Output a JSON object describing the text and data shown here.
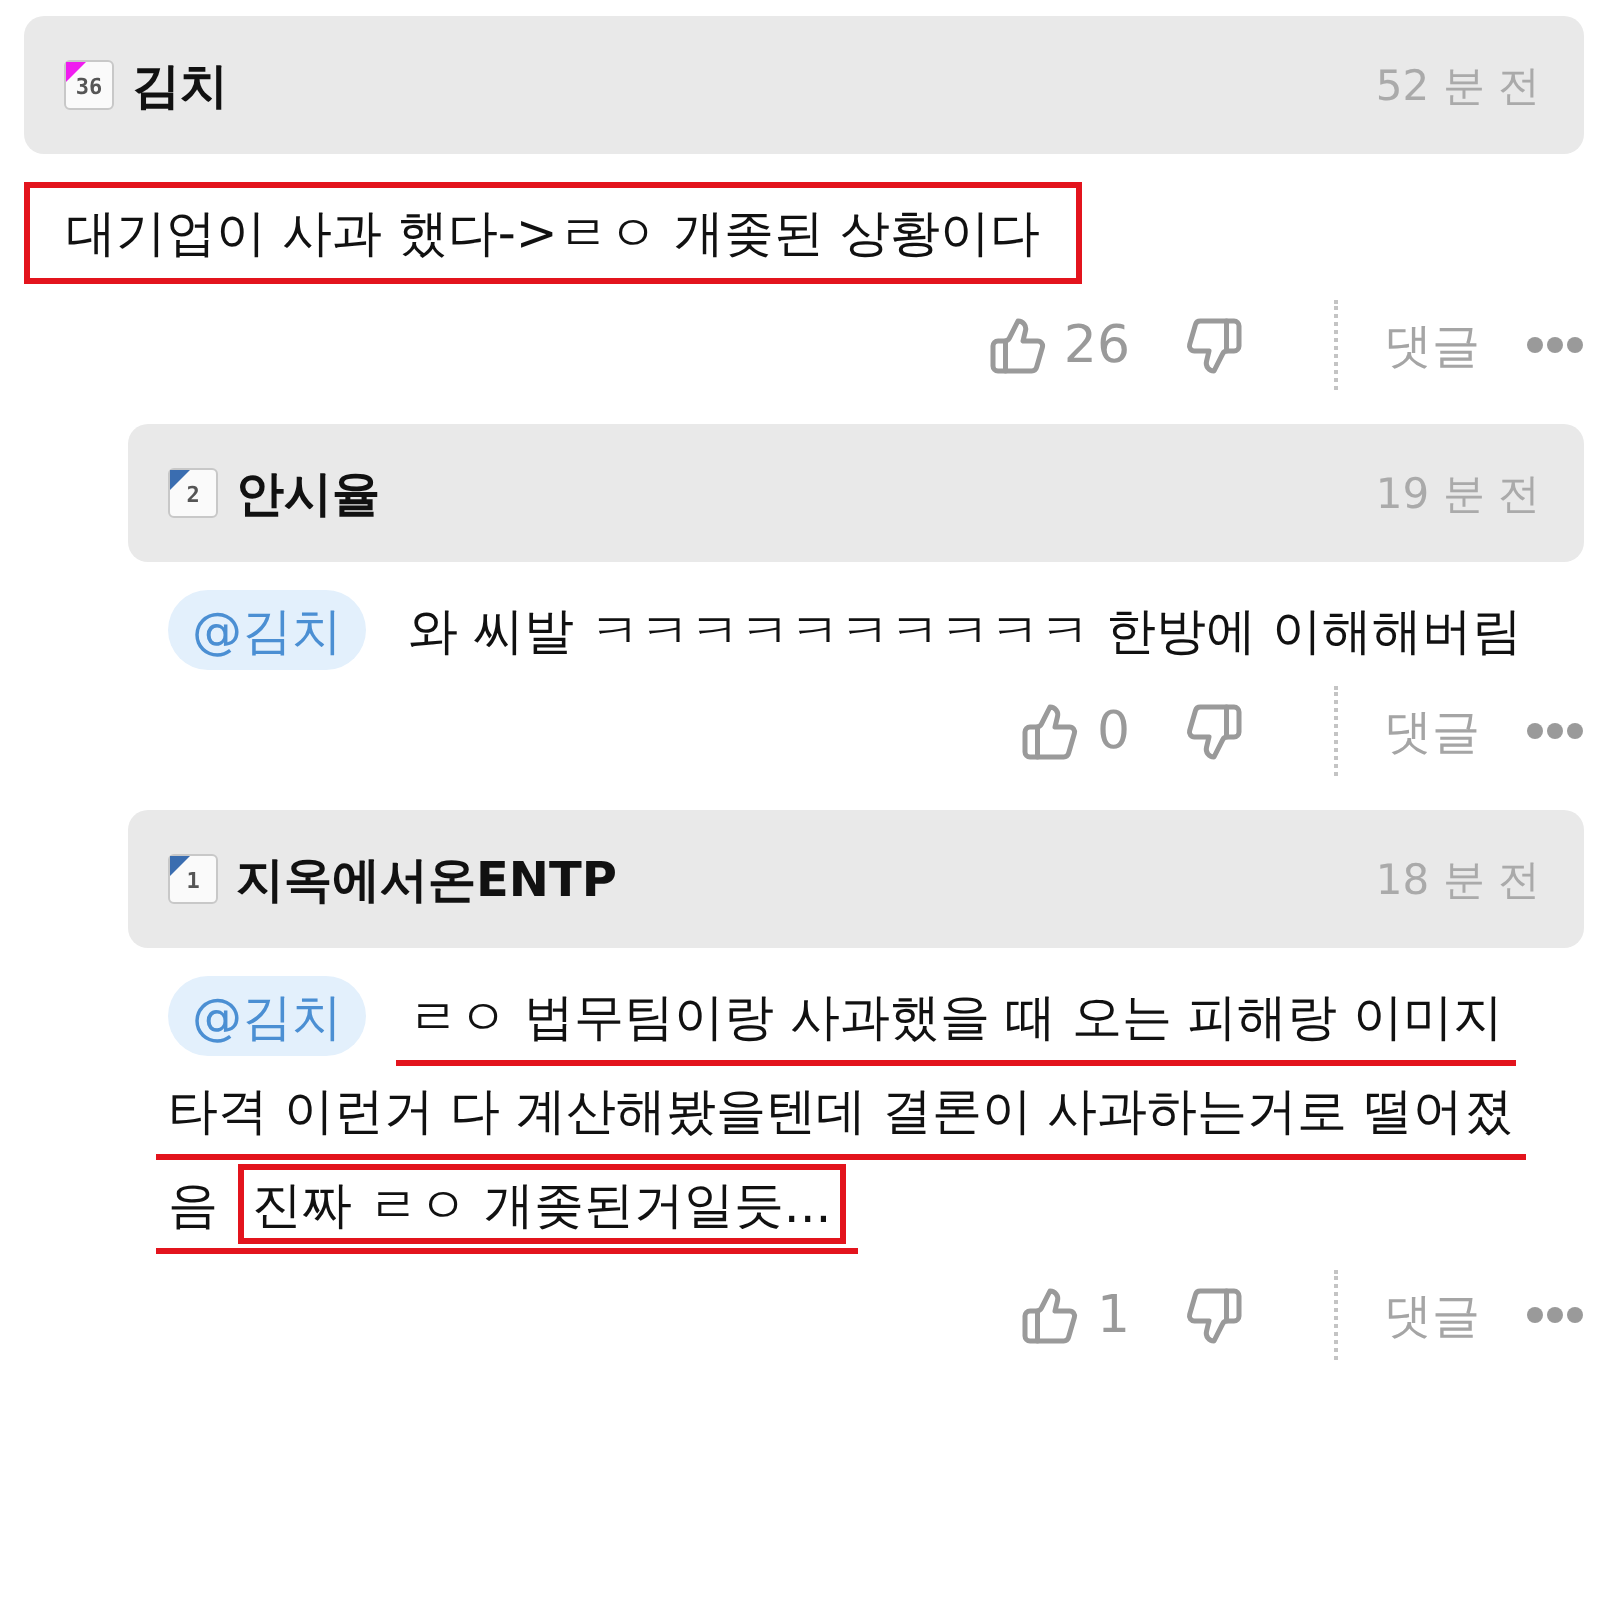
{
  "comments": [
    {
      "author": "김치",
      "level": "36",
      "color": "#f01cf0",
      "time": "52 분 전",
      "lines": [
        {
          "underlined": false,
          "segments": [
            {
              "text": "대기업이 사과 했다->ㄹㅇ 개좆된 상황이다",
              "boxed": true
            }
          ]
        }
      ],
      "likes": "26",
      "reply_label": "댓글",
      "children": [
        {
          "author": "안시율",
          "level": "2",
          "color": "#3a6db0",
          "time": "19 분 전",
          "mention": "@김치",
          "lines": [
            {
              "underlined": false,
              "segments": [
                {
                  "text": "와 씨발 ㅋㅋㅋㅋㅋㅋㅋㅋㅋㅋ 한방에 이해해버림",
                  "boxed": false
                }
              ]
            }
          ],
          "likes": "0",
          "reply_label": "댓글"
        },
        {
          "author": "지옥에서온ENTP",
          "level": "1",
          "color": "#3a6db0",
          "time": "18 분 전",
          "mention": "@김치",
          "lines": [
            {
              "underlined": true,
              "segments": [
                {
                  "text": "ㄹㅇ 법무팀이랑 사과했을 때 오는 피해랑 이미지",
                  "boxed": false
                }
              ]
            },
            {
              "underlined": true,
              "segments": [
                {
                  "text": "타격 이런거 다 계산해봤을텐데 결론이 사과하는거로 떨어졌",
                  "boxed": false
                }
              ]
            },
            {
              "underlined": true,
              "segments": [
                {
                  "text": "음",
                  "boxed": false
                },
                {
                  "text": "진짜 ㄹㅇ 개좆된거일듯...",
                  "boxed": true
                }
              ]
            }
          ],
          "likes": "1",
          "reply_label": "댓글"
        }
      ]
    }
  ]
}
